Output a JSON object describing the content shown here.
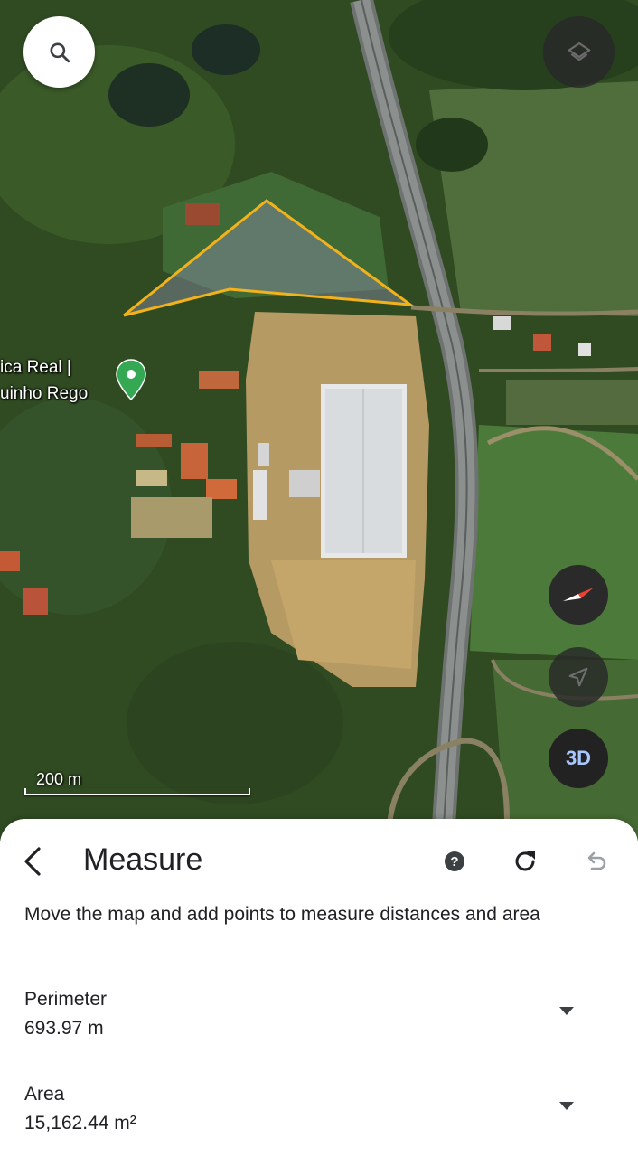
{
  "map": {
    "place_label_line1": "ica Real |",
    "place_label_line2": "uinho Rego",
    "scale_label": "200 m",
    "three_d_label": "3D",
    "colors": {
      "measure_line": "#f2b21b",
      "pin": "#34a853"
    },
    "icons": {
      "search": "search-icon",
      "layers": "layers-icon",
      "compass": "compass-icon",
      "locate": "navigation-arrow-icon"
    }
  },
  "sheet": {
    "title": "Measure",
    "instructions": "Move the map and add points to measure distances and area",
    "perimeter": {
      "label": "Perimeter",
      "value": "693.97 m"
    },
    "area": {
      "label": "Area",
      "value": "15,162.44 m²"
    },
    "icons": {
      "back": "chevron-left-icon",
      "help": "help-icon",
      "redo": "redo-icon",
      "undo": "undo-icon",
      "expand": "caret-down-icon"
    }
  }
}
